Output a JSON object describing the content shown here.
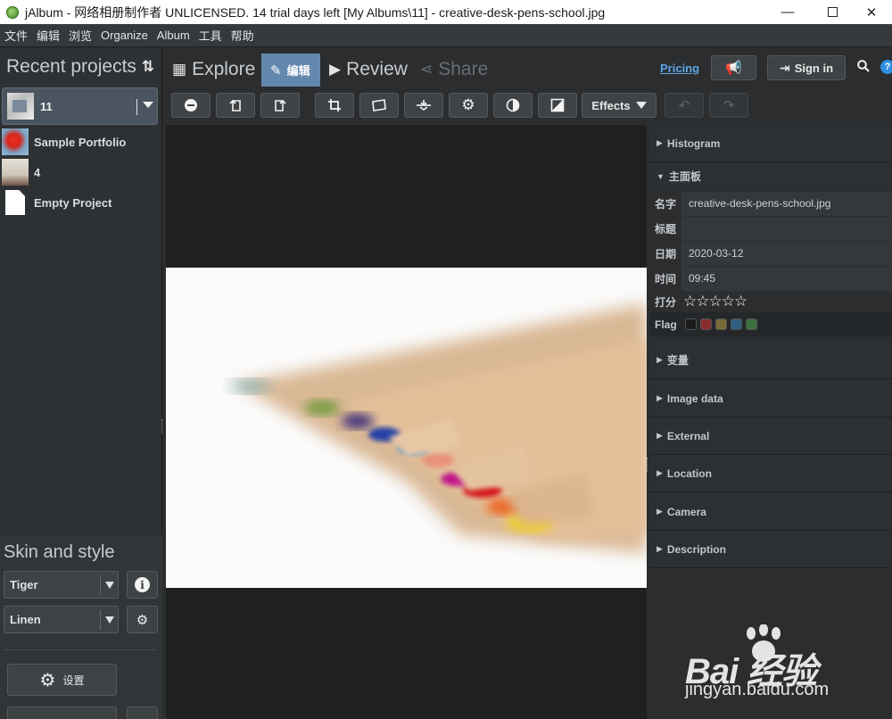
{
  "window": {
    "title": "jAlbum - 网络相册制作者 UNLICENSED. 14 trial days left [My Albums\\11] - creative-desk-pens-school.jpg",
    "min": "—",
    "close": "✕"
  },
  "menu": [
    "文件",
    "编辑",
    "浏览",
    "Organize",
    "Album",
    "工具",
    "帮助"
  ],
  "left": {
    "recent_title": "Recent projects",
    "sort_icon": "⇅",
    "current_project": "11",
    "projects": [
      {
        "name": "Sample Portfolio",
        "thumb": "poppy"
      },
      {
        "name": "4",
        "thumb": "photo4"
      },
      {
        "name": "Empty Project",
        "thumb": "empty"
      }
    ],
    "skin_title": "Skin and style",
    "skin": "Tiger",
    "style": "Linen",
    "info_icon": "i",
    "settings_label": "设置"
  },
  "nav": {
    "explore": "Explore",
    "edit": "编辑",
    "review": "Review",
    "share": "Share",
    "pricing": "Pricing",
    "signin": "Sign in",
    "help": "?"
  },
  "toolbar": {
    "effects": "Effects",
    "buttons": [
      "zoom-out",
      "rotate-left",
      "rotate-right",
      "crop",
      "straighten",
      "flip",
      "adjust",
      "contrast",
      "exposure"
    ]
  },
  "right": {
    "sections_top": [
      {
        "label": "Histogram"
      }
    ],
    "main_panel": "主面板",
    "fields": [
      {
        "label": "名字",
        "value": "creative-desk-pens-school.jpg"
      },
      {
        "label": "标题",
        "value": ""
      },
      {
        "label": "日期",
        "value": "2020-03-12"
      },
      {
        "label": "时间",
        "value": "09:45"
      }
    ],
    "rating_label": "打分",
    "stars": "☆☆☆☆☆",
    "flag_label": "Flag",
    "flag_colors": [
      "#1a1a1a",
      "#8b2d2d",
      "#7a6a3a",
      "#2f5e80",
      "#3d6e3d"
    ],
    "sections_bottom": [
      {
        "label": "变量"
      },
      {
        "label": "Image data"
      },
      {
        "label": "External"
      },
      {
        "label": "Location"
      },
      {
        "label": "Camera"
      },
      {
        "label": "Description"
      }
    ]
  },
  "watermark": {
    "main": "Bai 经验",
    "sub": "jingyan.baidu.com"
  }
}
